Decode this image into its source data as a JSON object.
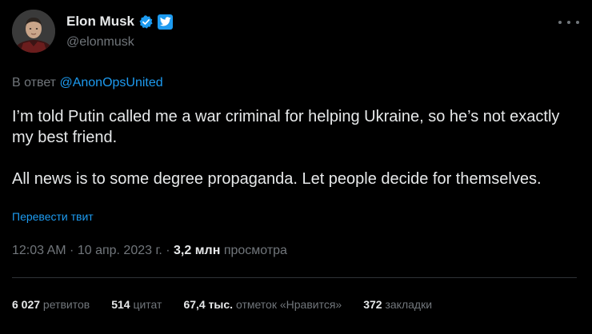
{
  "author": {
    "display_name": "Elon Musk",
    "handle": "@elonmusk",
    "avatar_icon": "profile-photo",
    "verified_icon": "verified-badge-icon",
    "affiliate_icon": "twitter-logo-icon"
  },
  "reply": {
    "prefix": "В ответ",
    "mention": "@AnonOpsUnited"
  },
  "tweet": {
    "paragraph_1": "I’m told Putin called me a war criminal for helping Ukraine, so he’s not exactly my best friend.",
    "paragraph_2": "All news is to some degree propaganda. Let people decide for themselves.",
    "translate_label": "Перевести твит"
  },
  "meta": {
    "time": "12:03 AM",
    "separator_1": " · ",
    "date": "10 апр. 2023 г.",
    "separator_2": " · ",
    "views_count": "3,2 млн",
    "views_label": " просмотра"
  },
  "stats": [
    {
      "value": "6 027",
      "label": " ретвитов"
    },
    {
      "value": "514",
      "label": " цитат"
    },
    {
      "value": "67,4 тыс.",
      "label": " отметок «Нравится»"
    },
    {
      "value": "372",
      "label": " закладки"
    }
  ],
  "colors": {
    "background": "#000000",
    "text_primary": "#e7e9ea",
    "text_secondary": "#71767b",
    "accent": "#1d9bf0",
    "divider": "#2f3336"
  }
}
